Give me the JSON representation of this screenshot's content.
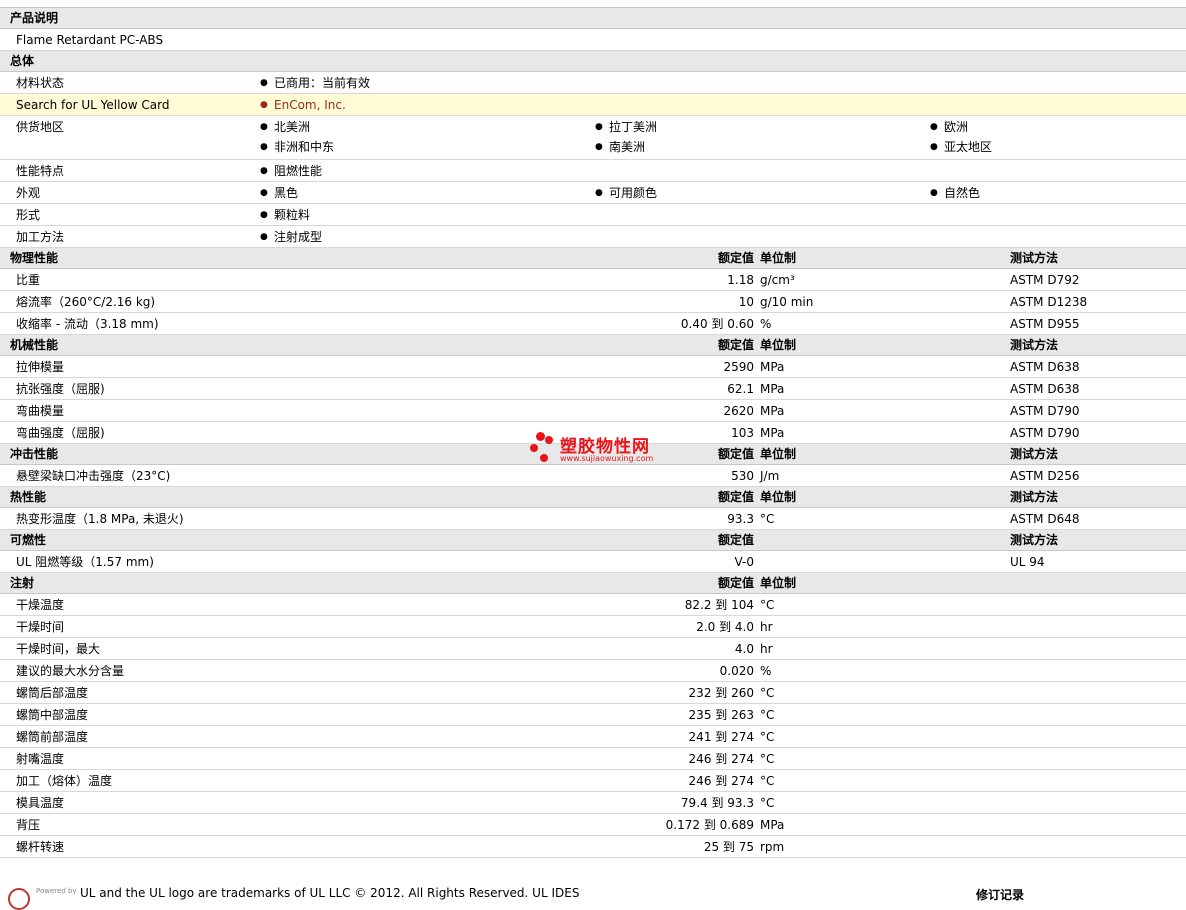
{
  "sections": [
    {
      "title": "产品说明",
      "rows": [
        {
          "label": "Flame Retardant PC-ABS"
        }
      ]
    },
    {
      "title": "总体",
      "rows": [
        {
          "label": "材料状态",
          "items": [
            "已商用：当前有效"
          ]
        },
        {
          "label": "Search for UL Yellow Card",
          "link": "EnCom, Inc.",
          "highlight": true
        },
        {
          "label": "供货地区",
          "items": [
            "北美洲",
            "拉丁美洲",
            "欧洲",
            "非洲和中东",
            "南美洲",
            "亚太地区"
          ]
        },
        {
          "label": "性能特点",
          "items": [
            "阻燃性能"
          ]
        },
        {
          "label": "外观",
          "items": [
            "黑色",
            "可用颜色",
            "自然色"
          ]
        },
        {
          "label": "形式",
          "items": [
            "颗粒料"
          ]
        },
        {
          "label": "加工方法",
          "items": [
            "注射成型"
          ]
        }
      ]
    },
    {
      "title": "物理性能",
      "hval": "额定值",
      "hunit": "单位制",
      "hmethod": "测试方法",
      "rows": [
        {
          "label": "比重",
          "value": "1.18",
          "unit": "g/cm³",
          "method": "ASTM D792"
        },
        {
          "label": "熔流率（260°C/2.16 kg)",
          "value": "10",
          "unit": "g/10 min",
          "method": "ASTM D1238"
        },
        {
          "label": "收缩率 - 流动（3.18 mm)",
          "value": "0.40 到  0.60",
          "unit": "%",
          "method": "ASTM D955"
        }
      ]
    },
    {
      "title": "机械性能",
      "hval": "额定值",
      "hunit": "单位制",
      "hmethod": "测试方法",
      "rows": [
        {
          "label": "拉伸模量",
          "value": "2590",
          "unit": "MPa",
          "method": "ASTM D638"
        },
        {
          "label": "抗张强度（屈服)",
          "value": "62.1",
          "unit": "MPa",
          "method": "ASTM D638"
        },
        {
          "label": "弯曲模量",
          "value": "2620",
          "unit": "MPa",
          "method": "ASTM D790"
        },
        {
          "label": "弯曲强度（屈服)",
          "value": "103",
          "unit": "MPa",
          "method": "ASTM D790"
        }
      ]
    },
    {
      "title": "冲击性能",
      "hval": "额定值",
      "hunit": "单位制",
      "hmethod": "测试方法",
      "rows": [
        {
          "label": "悬壁梁缺口冲击强度（23°C)",
          "value": "530",
          "unit": "J/m",
          "method": "ASTM D256"
        }
      ]
    },
    {
      "title": "热性能",
      "hval": "额定值",
      "hunit": "单位制",
      "hmethod": "测试方法",
      "rows": [
        {
          "label": "热变形温度（1.8 MPa, 未退火)",
          "value": "93.3",
          "unit": "°C",
          "method": "ASTM D648"
        }
      ]
    },
    {
      "title": "可燃性",
      "hval": "额定值",
      "hunit": "",
      "hmethod": "测试方法",
      "rows": [
        {
          "label": "UL 阻燃等级（1.57 mm)",
          "value": "V-0",
          "unit": "",
          "method": "UL 94"
        }
      ]
    },
    {
      "title": "注射",
      "hval": "额定值",
      "hunit": "单位制",
      "hmethod": "",
      "rows": [
        {
          "label": "干燥温度",
          "value": "82.2 到  104",
          "unit": "°C"
        },
        {
          "label": "干燥时间",
          "value": "2.0 到  4.0",
          "unit": "hr"
        },
        {
          "label": "干燥时间，最大",
          "value": "4.0",
          "unit": "hr"
        },
        {
          "label": "建议的最大水分含量",
          "value": "0.020",
          "unit": "%"
        },
        {
          "label": "螺筒后部温度",
          "value": "232 到  260",
          "unit": "°C"
        },
        {
          "label": "螺筒中部温度",
          "value": "235 到  263",
          "unit": "°C"
        },
        {
          "label": "螺筒前部温度",
          "value": "241 到  274",
          "unit": "°C"
        },
        {
          "label": "射嘴温度",
          "value": "246 到  274",
          "unit": "°C"
        },
        {
          "label": "加工（熔体）温度",
          "value": "246 到  274",
          "unit": "°C"
        },
        {
          "label": "模具温度",
          "value": "79.4 到  93.3",
          "unit": "°C"
        },
        {
          "label": "背压",
          "value": "0.172 到  0.689",
          "unit": "MPa"
        },
        {
          "label": "螺杆转速",
          "value": "25 到  75",
          "unit": "rpm"
        }
      ]
    }
  ],
  "watermark": {
    "title": "塑胶物性网",
    "url": "www.sujiaowuxing.com"
  },
  "footer": {
    "powered": "Powered by",
    "text": "UL and the UL logo are trademarks of UL LLC © 2012. All Rights Reserved. UL IDES",
    "revision": "修订记录"
  }
}
